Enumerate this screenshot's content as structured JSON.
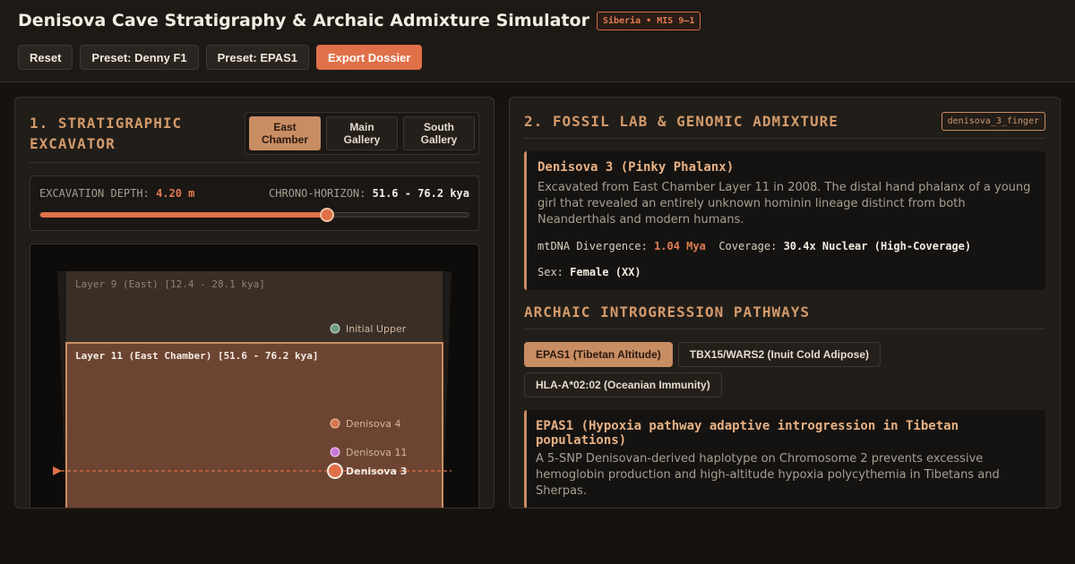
{
  "app": {
    "title": "Denisova Cave Stratigraphy & Archaic Admixture Simulator",
    "badge": "Siberia • MIS 9–1"
  },
  "toolbar": {
    "reset": "Reset",
    "preset_denny": "Preset: Denny F1",
    "preset_epas1": "Preset: EPAS1",
    "export": "Export Dossier"
  },
  "excavator": {
    "title_line1": "1. STRATIGRAPHIC",
    "title_line2": "EXCAVATOR",
    "chambers": [
      {
        "line1": "East",
        "line2": "Chamber",
        "active": true
      },
      {
        "line1": "Main",
        "line2": "Gallery",
        "active": false
      },
      {
        "line1": "South",
        "line2": "Gallery",
        "active": false
      }
    ],
    "depth_label": "EXCAVATION DEPTH:",
    "depth_value": "4.20 m",
    "horizon_label": "CHRONO-HORIZON:",
    "horizon_value": "51.6 - 76.2 kya",
    "depth_fraction": 0.67,
    "layers": [
      {
        "label": "Layer 9 (East) [12.4 - 28.1 kya]",
        "active": false
      },
      {
        "label": "Layer 11 (East Chamber) [51.6 - 76.2 kya]",
        "active": true
      }
    ],
    "fossils": [
      {
        "name": "Initial Upper",
        "color": "#6e9a86",
        "selected": false
      },
      {
        "name": "Denisova 4",
        "color": "#d3774f",
        "selected": false
      },
      {
        "name": "Denisova 11",
        "color": "#c77ad6",
        "selected": false
      },
      {
        "name": "Denisova 3",
        "color": "#e07048",
        "selected": true
      }
    ]
  },
  "lab": {
    "title": "2. FOSSIL LAB & GENOMIC ADMIXTURE",
    "specimen_id": "denisova_3_finger",
    "fossil": {
      "name": "Denisova 3 (Pinky Phalanx)",
      "description": "Excavated from East Chamber Layer 11 in 2008. The distal hand phalanx of a young girl that revealed an entirely unknown hominin lineage distinct from both Neanderthals and modern humans.",
      "mtdna_label": "mtDNA Divergence:",
      "mtdna_value": "1.04 Mya",
      "coverage_label": "Coverage:",
      "coverage_value": "30.4x Nuclear (High-Coverage)",
      "sex_label": "Sex:",
      "sex_value": "Female (XX)"
    },
    "pathways_title": "ARCHAIC INTROGRESSION PATHWAYS",
    "pathways": [
      {
        "label": "EPAS1 (Tibetan Altitude)",
        "active": true
      },
      {
        "label": "TBX15/WARS2 (Inuit Cold Adipose)",
        "active": false
      },
      {
        "label": "HLA-A*02:02 (Oceanian Immunity)",
        "active": false
      }
    ],
    "gene": {
      "title": "EPAS1 (Hypoxia pathway adaptive introgression in Tibetan populations)",
      "description": "A 5-SNP Denisovan-derived haplotype on Chromosome 2 prevents excessive hemoglobin production and high-altitude hypoxia polycythemia in Tibetans and Sherpas."
    }
  },
  "colors": {
    "accent": "#e07048",
    "tan": "#c98d63",
    "layer_active": "#6d4432"
  }
}
